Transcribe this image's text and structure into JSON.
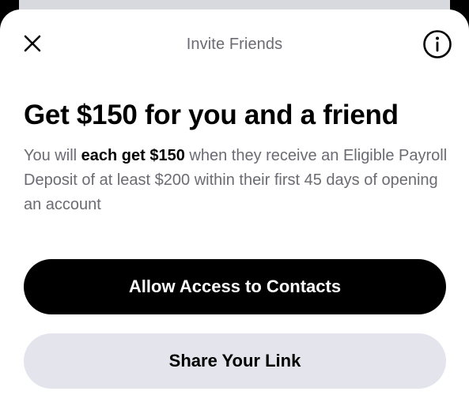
{
  "header": {
    "title": "Invite Friends",
    "close_icon": "close-icon",
    "info_icon": "info-icon"
  },
  "content": {
    "title": "Get $150 for you and a friend",
    "desc_part1": "You will ",
    "desc_bold": "each get $150",
    "desc_part2": " when they receive an Eligible Payroll Deposit of at least $200 within their first 45 days of opening an account"
  },
  "buttons": {
    "primary_label": "Allow Access to Contacts",
    "secondary_label": "Share Your Link"
  },
  "colors": {
    "backdrop": "#000000",
    "sheet": "#ffffff",
    "muted_text": "#6b6b73",
    "secondary_button": "#e4e5ec"
  }
}
